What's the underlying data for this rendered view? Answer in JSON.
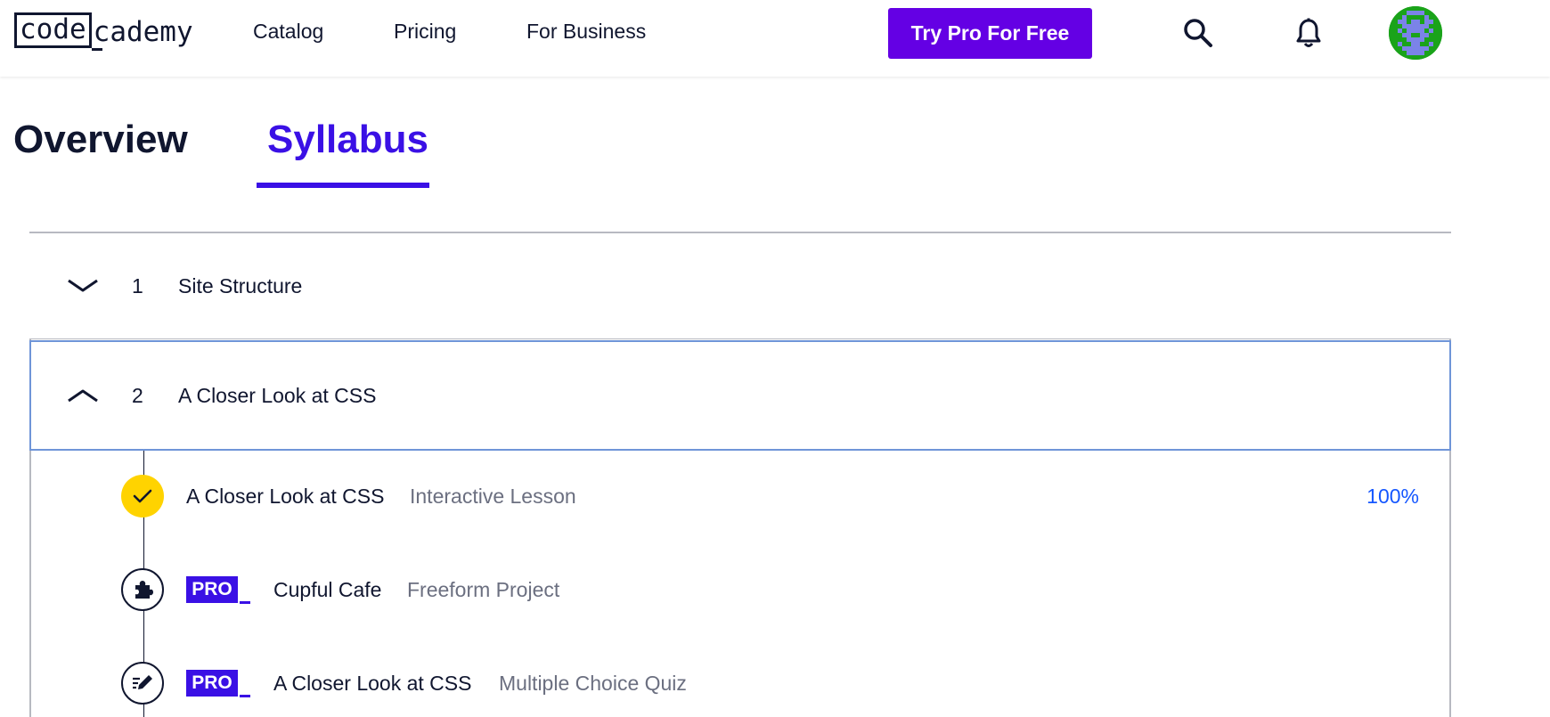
{
  "header": {
    "logo_left": "code",
    "logo_right": "cademy",
    "nav": [
      "Catalog",
      "Pricing",
      "For Business"
    ],
    "cta_label": "Try Pro For Free",
    "icons": [
      "search-icon",
      "bell-icon",
      "avatar"
    ]
  },
  "tabs": [
    {
      "label": "Overview",
      "active": false
    },
    {
      "label": "Syllabus",
      "active": true
    }
  ],
  "colors": {
    "brand_purple": "#6400e4",
    "active_tab": "#3a10e5",
    "pro_badge": "#3a10e5",
    "complete_yellow": "#ffd300",
    "progress_blue": "#1557ff",
    "avatar_green": "#1aa31a"
  },
  "modules": [
    {
      "number": "1",
      "title": "Site Structure",
      "expanded": false,
      "chevron": "chevron-down-icon"
    },
    {
      "number": "2",
      "title": "A Closer Look at CSS",
      "expanded": true,
      "chevron": "chevron-up-icon",
      "lessons": [
        {
          "title": "A Closer Look at CSS",
          "type": "Interactive Lesson",
          "pro": false,
          "status": "complete",
          "icon": "check-icon",
          "progress": "100%"
        },
        {
          "title": "Cupful Cafe",
          "type": "Freeform Project",
          "pro": true,
          "pro_label": "PRO",
          "status": "locked",
          "icon": "puzzle-icon"
        },
        {
          "title": "A Closer Look at CSS",
          "type": "Multiple Choice Quiz",
          "pro": true,
          "pro_label": "PRO",
          "status": "locked",
          "icon": "quiz-pencil-icon"
        }
      ]
    }
  ]
}
